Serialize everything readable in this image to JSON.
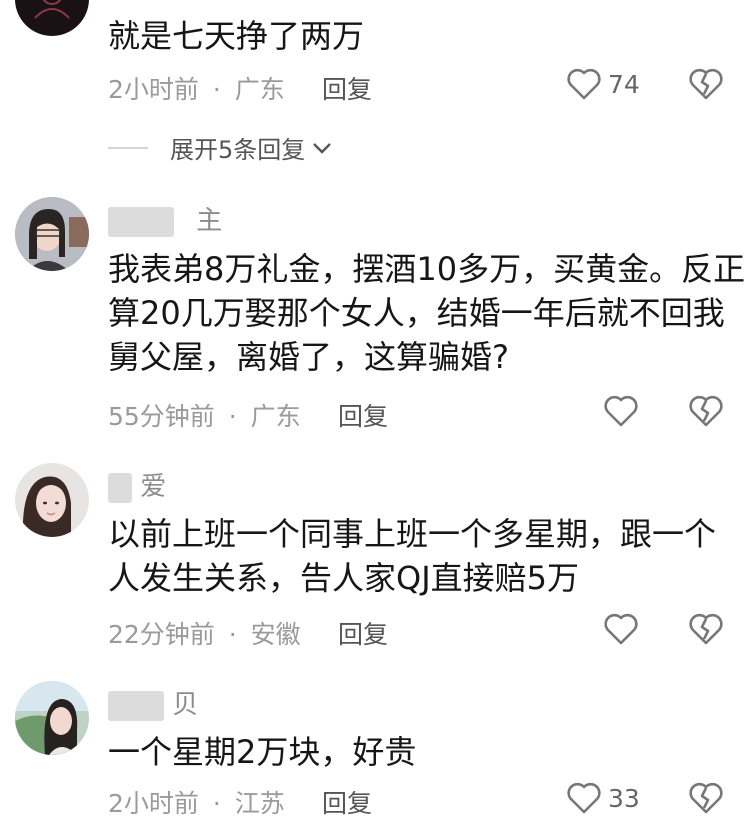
{
  "comments": [
    {
      "author": "",
      "text_lines": [
        "就是七天挣了两万"
      ],
      "time": "2小时前",
      "location": "广东",
      "reply_label": "回复",
      "likes": "74",
      "expand_label": "展开5条回复"
    },
    {
      "author": "主",
      "text_lines": [
        "我表弟8万礼金，摆酒10多万，买黄金。反正",
        "算20几万娶那个女人，结婚一年后就不回我",
        "舅父屋，离婚了，这算骗婚?"
      ],
      "time": "55分钟前",
      "location": "广东",
      "reply_label": "回复",
      "likes": ""
    },
    {
      "author": "爱",
      "text_lines": [
        "以前上班一个同事上班一个多星期，跟一个",
        "人发生关系，告人家QJ直接赔5万"
      ],
      "time": "22分钟前",
      "location": "安徽",
      "reply_label": "回复",
      "likes": ""
    },
    {
      "author": "贝",
      "text_lines": [
        "一个星期2万块，好贵"
      ],
      "time": "2小时前",
      "location": "江苏",
      "reply_label": "回复",
      "likes": "33"
    }
  ],
  "separator": "·",
  "icons": {
    "like": "heart-outline-icon",
    "dislike": "broken-heart-icon",
    "expand": "chevron-down-icon"
  }
}
